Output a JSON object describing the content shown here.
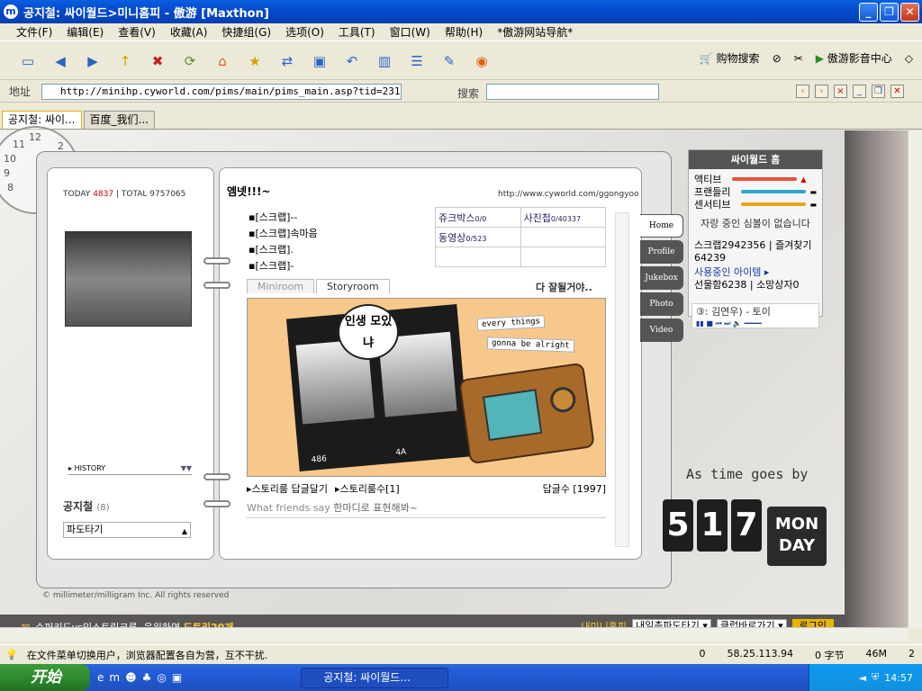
{
  "window": {
    "title": "공지철: 싸이월드>미니홈피 - 傲游 [Maxthon]",
    "controls": [
      "_",
      "❐",
      "✕"
    ]
  },
  "menu": [
    "文件(F)",
    "编辑(E)",
    "查看(V)",
    "收藏(A)",
    "快捷组(G)",
    "选项(O)",
    "工具(T)",
    "窗口(W)",
    "帮助(H)",
    "*傲游网站导航*"
  ],
  "toolbar": {
    "buttons": [
      "new-icon",
      "back-icon",
      "forward-icon",
      "up-icon",
      "stop-icon",
      "refresh-icon",
      "home-icon",
      "favorites-icon",
      "translate-icon",
      "screen-icon",
      "undo-icon",
      "columns-icon",
      "list-icon",
      "edit-icon",
      "rss-icon"
    ],
    "shopping_label": "购物搜索",
    "media_label": "傲游影音中心"
  },
  "address": {
    "label": "地址",
    "url": "http://minihp.cyworld.com/pims/main/pims_main.asp?tid=231922",
    "search_label": "搜索"
  },
  "tabs": [
    {
      "label": "공지철: 싸이...",
      "active": true
    },
    {
      "label": "百度_我们...",
      "active": false
    }
  ],
  "minihp": {
    "today_label": "TODAY",
    "today_count": "4837",
    "total_label": "TOTAL",
    "total_count": "9757065",
    "history_label": "HISTORY",
    "owner": "공지철",
    "owner_count": "(8)",
    "dotori_select": "파도타기",
    "copyright": "© millimeter/milligram Inc. All rights reserved",
    "title": "엠넷!!!~",
    "homepage_url": "http://www.cyworld.com/ggongyoo",
    "scraps": [
      "[스크랩]--",
      "[스크랩]속마음",
      "[스크랩].",
      "[스크랩]-"
    ],
    "stats": [
      {
        "label": "쥬크박스",
        "value": "0/0"
      },
      {
        "label": "사진첩",
        "value": "0/40337"
      },
      {
        "label": "동영상",
        "value": "0/523"
      },
      {
        "label": "",
        "value": ""
      }
    ],
    "room_tabs": [
      "Miniroom",
      "Storyroom"
    ],
    "room_note": "다 잘될거야..",
    "story_bubble": "인생 모있냐",
    "story_label_1": "every things",
    "story_label_2": "gonna be alright",
    "story_photo_num_1": "486",
    "story_photo_num_2": "4A",
    "story_links": [
      "스토리룸 답글달기",
      "스토리룸수[1]"
    ],
    "reply_count": "답글수 [1997]",
    "friends_say": "What friends say",
    "friends_say_hint": "한마디로 표현해봐~",
    "side_tabs": [
      "Home",
      "Profile",
      "Jukebox",
      "Photo",
      "Video"
    ]
  },
  "cymenu": {
    "title": "싸이월드 홈",
    "bars": [
      {
        "label": "액티브",
        "color": "#e0543a"
      },
      {
        "label": "프랜들리",
        "color": "#2fa6c9"
      },
      {
        "label": "센서티브",
        "color": "#e8a322"
      }
    ],
    "status": "자랑 중인 심볼이 없습니다",
    "scrap": "스크랩2942356",
    "fav": "즐겨찾기",
    "fav_count": "64239",
    "items_label": "사용중인 아이템",
    "gift": "선물함6238",
    "gift2": "소망상자0",
    "song": "③: 김연우) - 토이"
  },
  "clock_numbers": [
    "12",
    "11",
    "10",
    "9",
    "8",
    "3",
    "2"
  ],
  "decor": {
    "as_time": "As time goes by",
    "date_digits": [
      "5",
      "1",
      "7"
    ],
    "date_day": [
      "MON",
      "DAY"
    ]
  },
  "bottom": {
    "promo_1": "슈퍼키드vs익스트림크루, 응원하면",
    "promo_highlight": "도토리20개",
    "my_home": "내미니홈피",
    "select_1": "내일촌파도타기",
    "select_2": "클럽바로가기",
    "login": "로그인"
  },
  "statusbar": {
    "message": "在文件菜单切换用户，浏览器配置各自为营，互不干扰.",
    "counter": "0",
    "ip": "58.25.113.94",
    "bytes": "0 字节",
    "mem": "46M",
    "num": "2"
  },
  "taskbar": {
    "start": "开始",
    "task": "공지철: 싸이월드...",
    "time": "14:57"
  }
}
